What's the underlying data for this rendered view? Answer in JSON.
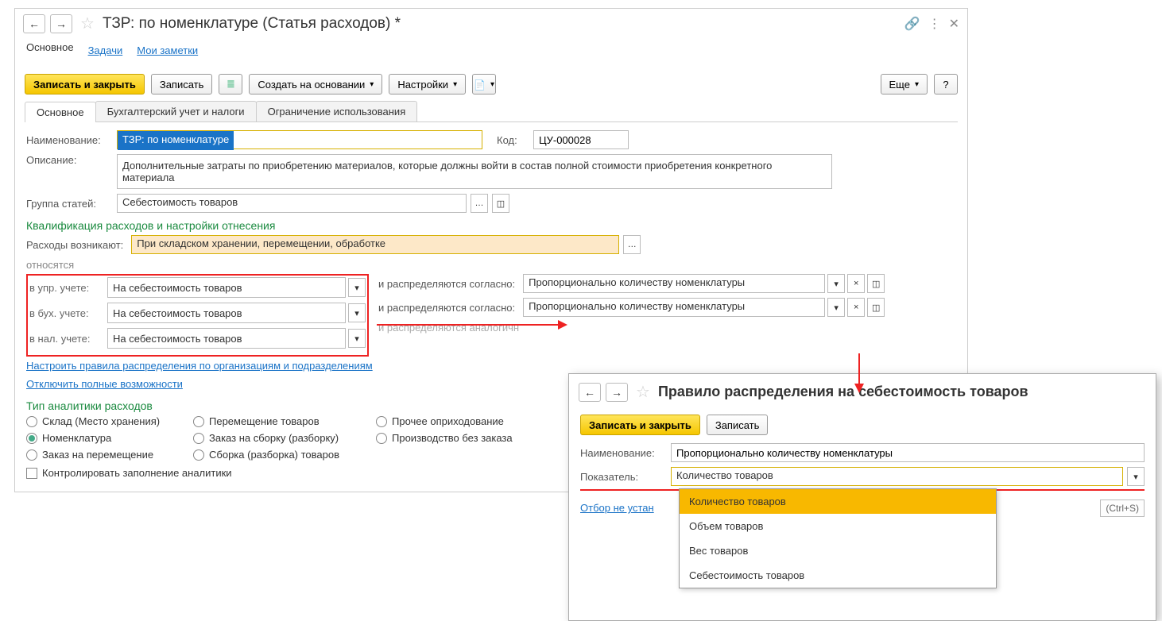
{
  "title": "ТЗР: по номенклатуре (Статья расходов) *",
  "subnav": {
    "main": "Основное",
    "tasks": "Задачи",
    "notes": "Мои заметки"
  },
  "toolbar": {
    "save_close": "Записать и закрыть",
    "save": "Записать",
    "create_based": "Создать на основании",
    "settings": "Настройки",
    "more": "Еще",
    "help": "?"
  },
  "tabs": {
    "main": "Основное",
    "acc": "Бухгалтерский учет и налоги",
    "restrict": "Ограничение использования"
  },
  "fields": {
    "name_label": "Наименование:",
    "name_value": "ТЗР: по номенклатуре",
    "code_label": "Код:",
    "code_value": "ЦУ-000028",
    "desc_label": "Описание:",
    "desc_value": "Дополнительные затраты по приобретению материалов, которые должны войти в состав полной стоимости приобретения конкретного материала",
    "group_label": "Группа статей:",
    "group_value": "Себестоимость товаров"
  },
  "qual": {
    "title": "Квалификация расходов и настройки отнесения",
    "expenses_label": "Расходы возникают:",
    "expenses_value": "При складском хранении, перемещении, обработке",
    "relates": "относятся",
    "upr_label": "в упр. учете:",
    "buh_label": "в бух. учете:",
    "nal_label": "в нал. учете:",
    "target_value": "На себестоимость товаров",
    "dist_label": "и распределяются согласно:",
    "dist_label_grey": "и распределяются аналогичн",
    "dist_value": "Пропорционально количеству номенклатуры",
    "link1": "Настроить правила распределения по организациям и подразделениям",
    "link2": "Отключить полные возможности"
  },
  "analytics": {
    "title": "Тип аналитики расходов",
    "r1": "Склад (Место хранения)",
    "r2": "Номенклатура",
    "r3": "Заказ на перемещение",
    "r4": "Перемещение товаров",
    "r5": "Заказ на сборку (разборку)",
    "r6": "Сборка (разборка) товаров",
    "r7": "Прочее оприходование",
    "r8": "Производство без заказа",
    "control_label": "Контролировать заполнение аналитики"
  },
  "popup": {
    "title": "Правило распределения на себестоимость товаров",
    "save_close": "Записать и закрыть",
    "save": "Записать",
    "name_label": "Наименование:",
    "name_value": "Пропорционально количеству номенклатуры",
    "indicator_label": "Показатель:",
    "indicator_value": "Количество товаров",
    "filter_link": "Отбор не устан",
    "hint": "(Ctrl+S)",
    "options": [
      "Количество товаров",
      "Объем товаров",
      "Вес товаров",
      "Себестоимость товаров"
    ]
  }
}
